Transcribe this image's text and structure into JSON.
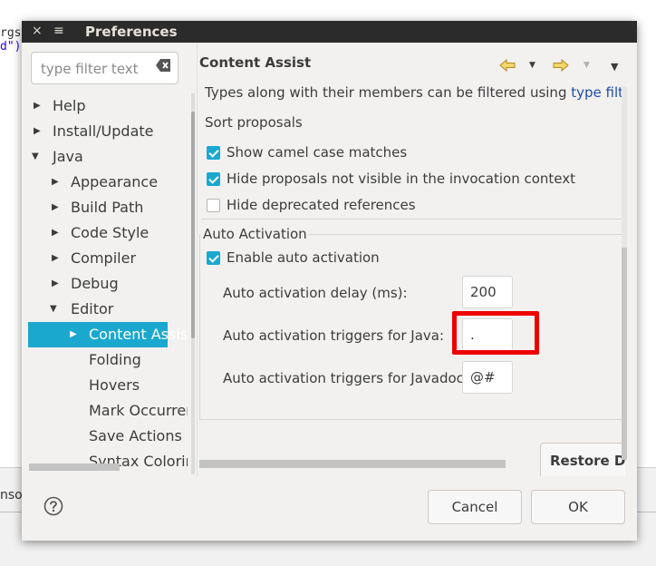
{
  "background": {
    "code_line1": "rgs",
    "code_line2": "d\")",
    "console_label": "nsol"
  },
  "window": {
    "title": "Preferences",
    "close_glyph": "×",
    "menu_glyph": "≡"
  },
  "filter": {
    "placeholder": "type filter text"
  },
  "tree": {
    "items": [
      {
        "label": "Help",
        "expanded": false
      },
      {
        "label": "Install/Update",
        "expanded": false
      },
      {
        "label": "Java",
        "expanded": true
      },
      {
        "label": "Appearance",
        "expanded": false
      },
      {
        "label": "Build Path",
        "expanded": false
      },
      {
        "label": "Code Style",
        "expanded": false
      },
      {
        "label": "Compiler",
        "expanded": false
      },
      {
        "label": "Debug",
        "expanded": false
      },
      {
        "label": "Editor",
        "expanded": true
      },
      {
        "label": "Content Assist",
        "expanded": false,
        "selected": true
      },
      {
        "label": "Folding"
      },
      {
        "label": "Hovers"
      },
      {
        "label": "Mark Occurrences"
      },
      {
        "label": "Save Actions"
      },
      {
        "label": "Syntax Coloring"
      }
    ]
  },
  "page": {
    "title": "Content Assist",
    "filter_text_prefix": "Types along with their members can be filtered using ",
    "filter_link": "type filters",
    "sort_label": "Sort proposals",
    "options": [
      {
        "label": "Show camel case matches",
        "checked": true
      },
      {
        "label": "Hide proposals not visible in the invocation context",
        "checked": true
      },
      {
        "label": "Hide deprecated references",
        "checked": false
      }
    ],
    "auto_activation": {
      "group_label": "Auto Activation",
      "enable_label": "Enable auto activation",
      "enable_checked": true,
      "delay_label": "Auto activation delay (ms):",
      "delay_value": "200",
      "java_label": "Auto activation triggers for Java:",
      "java_value": ".",
      "javadoc_label": "Auto activation triggers for Javadoc:",
      "javadoc_value": "@#"
    },
    "restore_defaults_label": "Restore Defaults"
  },
  "buttons": {
    "cancel": "Cancel",
    "ok": "OK"
  },
  "colors": {
    "selection": "#1aa8cf",
    "highlight": "#ee0000",
    "titlebar": "#2b2b2b"
  }
}
